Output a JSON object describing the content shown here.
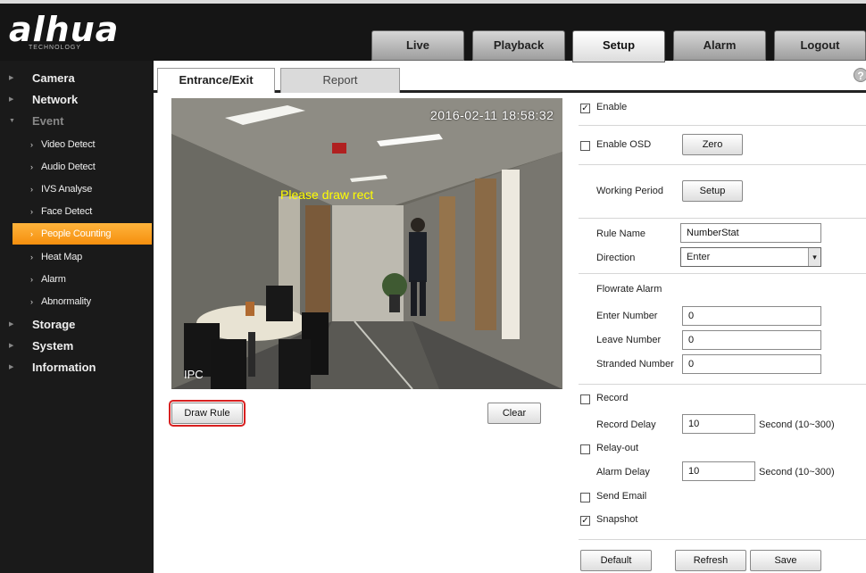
{
  "header": {
    "logo_text": "alhua",
    "logo_sub": "TECHNOLOGY",
    "nav": [
      "Live",
      "Playback",
      "Setup",
      "Alarm",
      "Logout"
    ],
    "active_nav": "Setup"
  },
  "sidebar": {
    "items": [
      {
        "label": "Camera",
        "level": "top"
      },
      {
        "label": "Network",
        "level": "top"
      },
      {
        "label": "Event",
        "level": "top",
        "expanded": true
      },
      {
        "label": "Video Detect",
        "level": "sub"
      },
      {
        "label": "Audio Detect",
        "level": "sub"
      },
      {
        "label": "IVS Analyse",
        "level": "sub"
      },
      {
        "label": "Face Detect",
        "level": "sub"
      },
      {
        "label": "People Counting",
        "level": "sub",
        "active": true
      },
      {
        "label": "Heat Map",
        "level": "sub"
      },
      {
        "label": "Alarm",
        "level": "sub"
      },
      {
        "label": "Abnormality",
        "level": "sub"
      },
      {
        "label": "Storage",
        "level": "top"
      },
      {
        "label": "System",
        "level": "top"
      },
      {
        "label": "Information",
        "level": "top"
      }
    ]
  },
  "tabs": [
    "Entrance/Exit",
    "Report"
  ],
  "video": {
    "timestamp": "2016-02-11 18:58:32",
    "overlay_text": "Please draw rect",
    "channel_label": "IPC"
  },
  "buttons": {
    "draw_rule": "Draw Rule",
    "clear": "Clear",
    "zero": "Zero",
    "setup": "Setup",
    "default": "Default",
    "refresh": "Refresh",
    "save": "Save"
  },
  "form": {
    "enable": {
      "label": "Enable",
      "checked": true
    },
    "enable_osd": {
      "label": "Enable OSD",
      "checked": false
    },
    "working_period_label": "Working Period",
    "rule_name": {
      "label": "Rule Name",
      "value": "NumberStat"
    },
    "direction": {
      "label": "Direction",
      "value": "Enter"
    },
    "flowrate_alarm_label": "Flowrate Alarm",
    "enter_number": {
      "label": "Enter Number",
      "value": "0"
    },
    "leave_number": {
      "label": "Leave Number",
      "value": "0"
    },
    "stranded_number": {
      "label": "Stranded Number",
      "value": "0"
    },
    "record": {
      "label": "Record",
      "checked": false
    },
    "record_delay": {
      "label": "Record Delay",
      "value": "10",
      "unit": "Second (10~300)"
    },
    "relay_out": {
      "label": "Relay-out",
      "checked": false
    },
    "alarm_delay": {
      "label": "Alarm Delay",
      "value": "10",
      "unit": "Second (10~300)"
    },
    "send_email": {
      "label": "Send Email",
      "checked": false
    },
    "snapshot": {
      "label": "Snapshot",
      "checked": true
    }
  },
  "colors": {
    "accent": "#f5a020",
    "highlight_border": "#d82020",
    "sidebar_bg": "#1a1a1a"
  }
}
